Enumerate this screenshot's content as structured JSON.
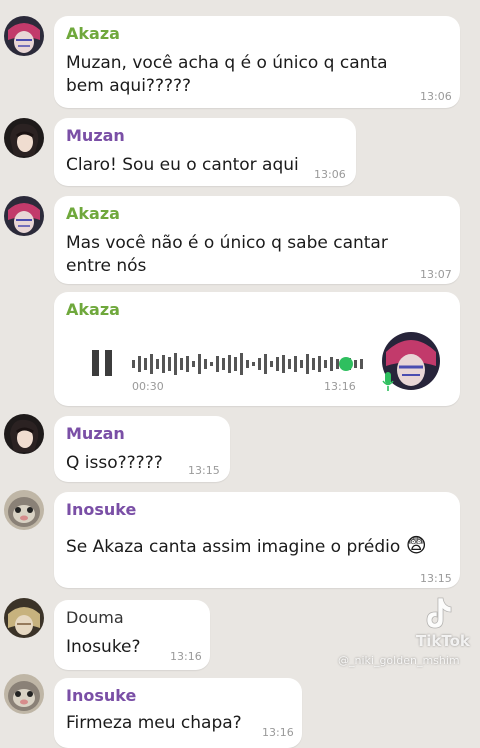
{
  "messages": [
    {
      "sender": "Akaza",
      "text": "Muzan, você acha q é o único q canta bem aqui?????",
      "time": "13:06"
    },
    {
      "sender": "Muzan",
      "text": "Claro! Sou eu o cantor aqui",
      "time": "13:06"
    },
    {
      "sender": "Akaza",
      "text": "Mas você não é o único q sabe cantar entre nós",
      "time": "13:07"
    },
    {
      "sender": "Akaza",
      "voice_duration": "00:30",
      "time": "13:16"
    },
    {
      "sender": "Muzan",
      "text": "Q isso?????",
      "time": "13:15"
    },
    {
      "sender": "Inosuke",
      "text": "Se Akaza canta assim imagine o prédio",
      "time": "13:15"
    },
    {
      "sender": "Douma",
      "text": "Inosuke?",
      "time": "13:16"
    },
    {
      "sender": "Inosuke",
      "text": "Firmeza meu chapa?",
      "time": "13:16"
    }
  ],
  "colors": {
    "akaza": "#6fa83c",
    "muzan": "#7a4fa6",
    "inosuke": "#7a4fa6",
    "douma": "#333333",
    "mic": "#2fbf5f"
  },
  "watermark": {
    "brand": "TikTok",
    "user": "@_niki_golden_mshim"
  },
  "voice": {
    "emoji": "😨"
  }
}
